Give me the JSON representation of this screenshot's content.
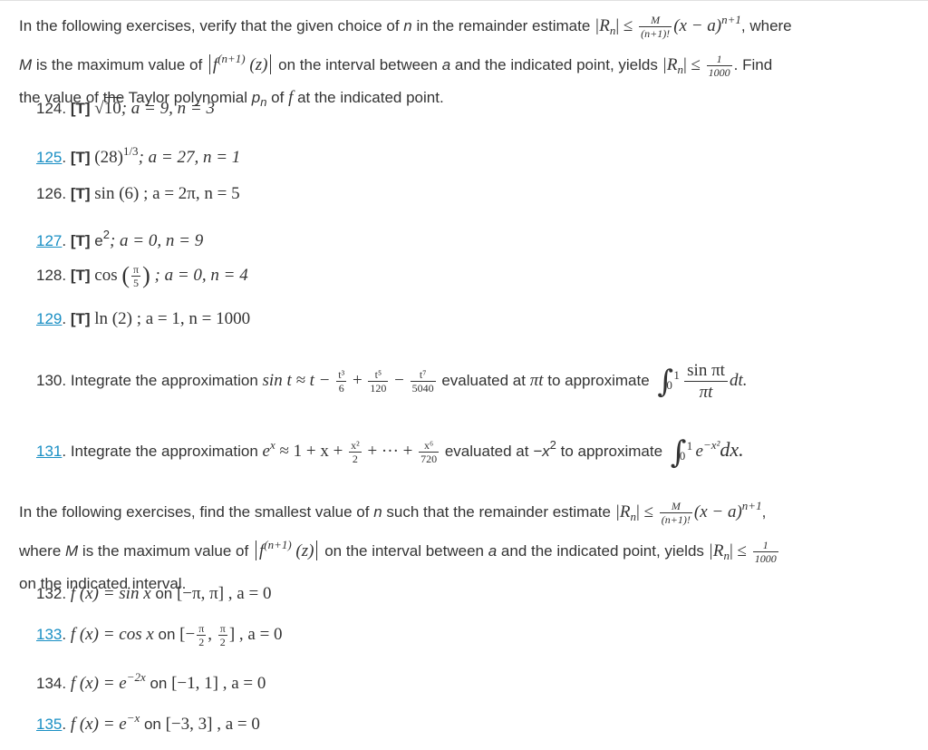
{
  "section1": {
    "intro_part1": "In the following exercises, verify that the given choice of ",
    "intro_n": "n",
    "intro_part2": " in the remainder estimate ",
    "intro_part3": ", where",
    "intro_M": "M",
    "intro_part4": " is the maximum value of ",
    "intro_part5": " on the interval between ",
    "intro_a": "a",
    "intro_part6": " and the indicated point, yields ",
    "intro_part7": ". Find",
    "intro_part8": "the value of the Taylor polynomial ",
    "intro_pn": "p",
    "intro_pn_sub": "n",
    "intro_part9": " of ",
    "intro_f": "f",
    "intro_part10": " at the indicated point.",
    "remainder_lhs": "|R",
    "remainder_sub": "n",
    "remainder_rel": "| ≤ ",
    "remainder_frac_num": "M",
    "remainder_frac_den": "(n+1)!",
    "remainder_tail": "(x − a)",
    "remainder_exp": "n+1",
    "deriv_f": "f",
    "deriv_exp": "(n+1)",
    "deriv_arg": " (z)",
    "bound_frac_num": "1",
    "bound_frac_den": "1000"
  },
  "exercises1": [
    {
      "number": "124",
      "linked": false,
      "tag": "[T]",
      "expr_prefix": "",
      "sqrt": "10",
      "rest": "; a = 9, n = 3"
    },
    {
      "number": "125",
      "linked": true,
      "tag": "[T]",
      "expr": "(28)",
      "exp": "1/3",
      "rest": "; a = 27, n = 1"
    },
    {
      "number": "126",
      "linked": false,
      "tag": "[T]",
      "expr": "sin (6) ; a = 2π, n = 5"
    },
    {
      "number": "127",
      "linked": true,
      "tag": "[T]",
      "expr_text": "e",
      "exp": "2",
      "rest": "; a = 0, n = 9"
    },
    {
      "number": "128",
      "linked": false,
      "tag": "[T]",
      "fn": "cos",
      "frac_num": "π",
      "frac_den": "5",
      "rest": " ; a = 0, n = 4"
    },
    {
      "number": "129",
      "linked": true,
      "tag": "[T]",
      "expr": "ln (2) ; a = 1, n = 1000"
    }
  ],
  "exercise130": {
    "number": "130",
    "text1": "Integrate the approximation ",
    "approx": "sin t ≈ t − ",
    "f1_num": "t³",
    "f1_den": "6",
    "op1": " + ",
    "f2_num": "t⁵",
    "f2_den": "120",
    "op2": " − ",
    "f3_num": "t⁷",
    "f3_den": "5040",
    "text2": " evaluated at ",
    "eval_at": "πt",
    "text3": " to approximate ",
    "int_upper": "1",
    "int_lower": "0",
    "integrand_num": "sin πt",
    "integrand_den": "πt",
    "differential": "dt."
  },
  "exercise131": {
    "number": "131",
    "text1": ". Integrate the approximation ",
    "lhs": "e",
    "lhs_exp": "x",
    "approx": " ≈ 1 + x + ",
    "f1_num": "x²",
    "f1_den": "2",
    "mid": " + ··· + ",
    "f2_num": "x⁶",
    "f2_den": "720",
    "text2": " evaluated at ",
    "eval_at": "−x",
    "eval_exp": "2",
    "text3": " to approximate ",
    "int_upper": "1",
    "int_lower": "0",
    "integrand": "e",
    "integrand_exp": "−x²",
    "differential": "dx."
  },
  "section2": {
    "intro_part1": "In the following exercises, find the smallest value of ",
    "intro_n": "n",
    "intro_part2": " such that the remainder estimate ",
    "intro_part3": ",",
    "intro_part4": "where ",
    "intro_M": "M",
    "intro_part5": " is the maximum value of ",
    "intro_part6": " on the interval between ",
    "intro_a": "a",
    "intro_part7": " and the indicated point, yields ",
    "intro_part8": "on the indicated interval."
  },
  "exercises2": [
    {
      "number": "132",
      "linked": false,
      "lhs": "f (x) = sin x",
      "on": " on ",
      "interval": "[−π, π] , a = 0"
    },
    {
      "number": "133",
      "linked": true,
      "lhs": "f (x) = cos x",
      "on": " on ",
      "interval_open": "[−",
      "frac_num": "π",
      "frac_den": "2",
      "sep": ", ",
      "interval_close": "] , a = 0"
    },
    {
      "number": "134",
      "linked": false,
      "lhs": "f (x) = e",
      "exp": "−2x",
      "on": " on ",
      "interval": "[−1, 1] , a = 0"
    },
    {
      "number": "135",
      "linked": true,
      "lhs": "f (x) = e",
      "exp": "−x",
      "on": " on ",
      "interval": "[−3, 3] , a = 0"
    }
  ],
  "colors": {
    "text": "#333333",
    "link": "#1a8fc4",
    "background": "#ffffff"
  }
}
